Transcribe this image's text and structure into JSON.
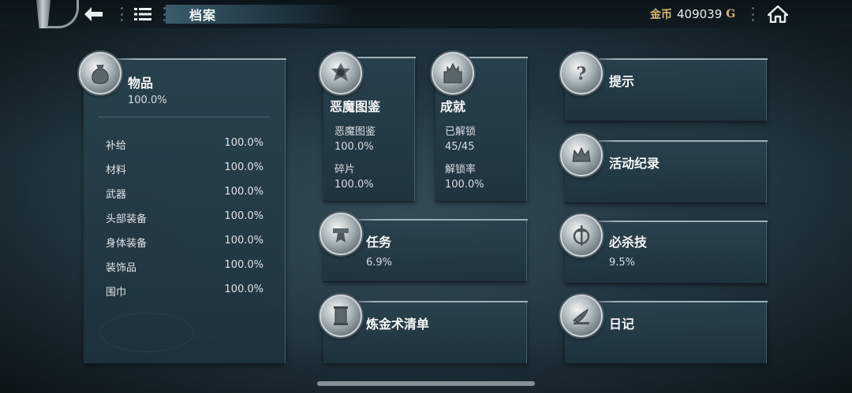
{
  "header": {
    "title": "档案",
    "currency_label": "金币",
    "currency_value": "409039",
    "currency_unit": "G"
  },
  "items_panel": {
    "title": "物品",
    "percent": "100.0%",
    "rows": [
      {
        "label": "补给",
        "value": "100.0%"
      },
      {
        "label": "材料",
        "value": "100.0%"
      },
      {
        "label": "武器",
        "value": "100.0%"
      },
      {
        "label": "头部装备",
        "value": "100.0%"
      },
      {
        "label": "身体装备",
        "value": "100.0%"
      },
      {
        "label": "装饰品",
        "value": "100.0%"
      },
      {
        "label": "围巾",
        "value": "100.0%"
      }
    ]
  },
  "demon_panel": {
    "title": "恶魔图鉴",
    "line1_label": "恶魔图鉴",
    "line1_value": "100.0%",
    "line2_label": "碎片",
    "line2_value": "100.0%"
  },
  "achievement_panel": {
    "title": "成就",
    "line1_label": "已解锁",
    "line1_value": "45/45",
    "line2_label": "解锁率",
    "line2_value": "100.0%"
  },
  "quest_panel": {
    "title": "任务",
    "percent": "6.9%"
  },
  "alchemy_panel": {
    "title": "炼金术清单"
  },
  "tips_panel": {
    "title": "提示"
  },
  "activity_panel": {
    "title": "活动纪录"
  },
  "skill_panel": {
    "title": "必杀技",
    "percent": "9.5%"
  },
  "diary_panel": {
    "title": "日记"
  },
  "icons": {
    "back": "back-arrow-icon",
    "menu": "list-menu-icon",
    "home": "home-icon"
  },
  "colors": {
    "currency_gold": "#d9b870",
    "panel_bg": "#2a424e",
    "accent_silver": "#cfd6da"
  }
}
